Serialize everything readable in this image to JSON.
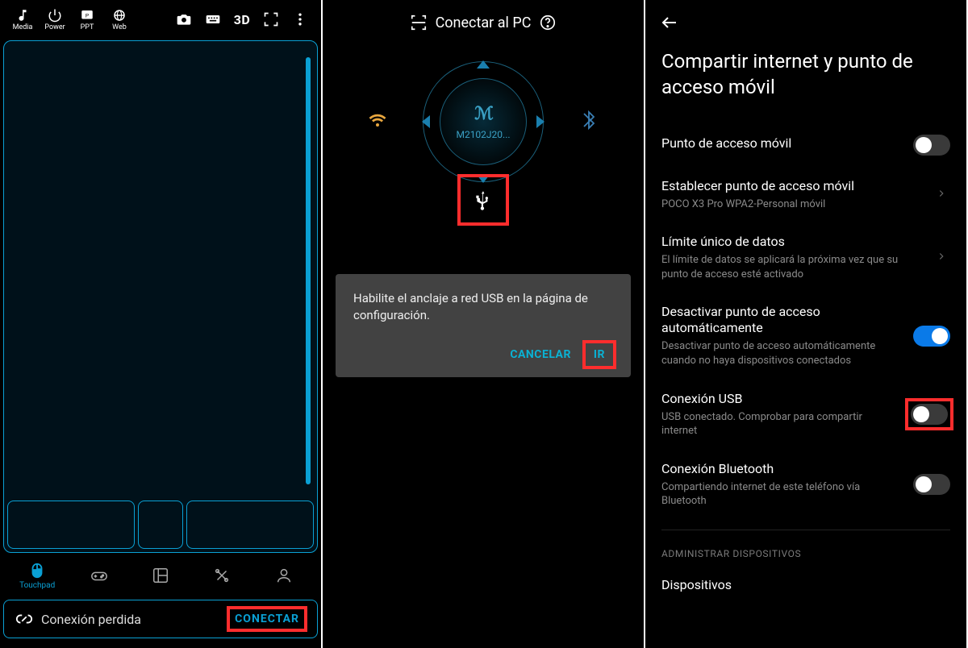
{
  "panel1": {
    "topIcons": {
      "media": "Media",
      "power": "Power",
      "ppt": "PPT",
      "web": "Web",
      "threeD": "3D"
    },
    "nav": {
      "touchpad": "Touchpad"
    },
    "status": {
      "text": "Conexión perdida",
      "connect": "CONECTAR"
    }
  },
  "panel2": {
    "title": "Conectar al PC",
    "device": "M2102J20...",
    "dialog": {
      "text": "Habilite el anclaje a red USB en la página de configuración.",
      "cancel": "CANCELAR",
      "go": "IR"
    }
  },
  "panel3": {
    "title": "Compartir internet y punto de acceso móvil",
    "items": {
      "hotspot": {
        "label": "Punto de acceso móvil"
      },
      "setup": {
        "label": "Establecer punto de acceso móvil",
        "sub": "POCO X3 Pro WPA2-Personal móvil"
      },
      "limit": {
        "label": "Límite único de datos",
        "sub": "El límite de datos se aplicará la próxima vez que su punto de acceso esté activado"
      },
      "autoOff": {
        "label": "Desactivar punto de acceso automáticamente",
        "sub": "Desactivar punto de acceso automáticamente cuando no haya dispositivos conectados"
      },
      "usb": {
        "label": "Conexión USB",
        "sub": "USB conectado. Comprobar para compartir internet"
      },
      "bt": {
        "label": "Conexión Bluetooth",
        "sub": "Compartiendo internet de este teléfono vía Bluetooth"
      }
    },
    "section": "ADMINISTRAR DISPOSITIVOS",
    "devices": "Dispositivos"
  }
}
